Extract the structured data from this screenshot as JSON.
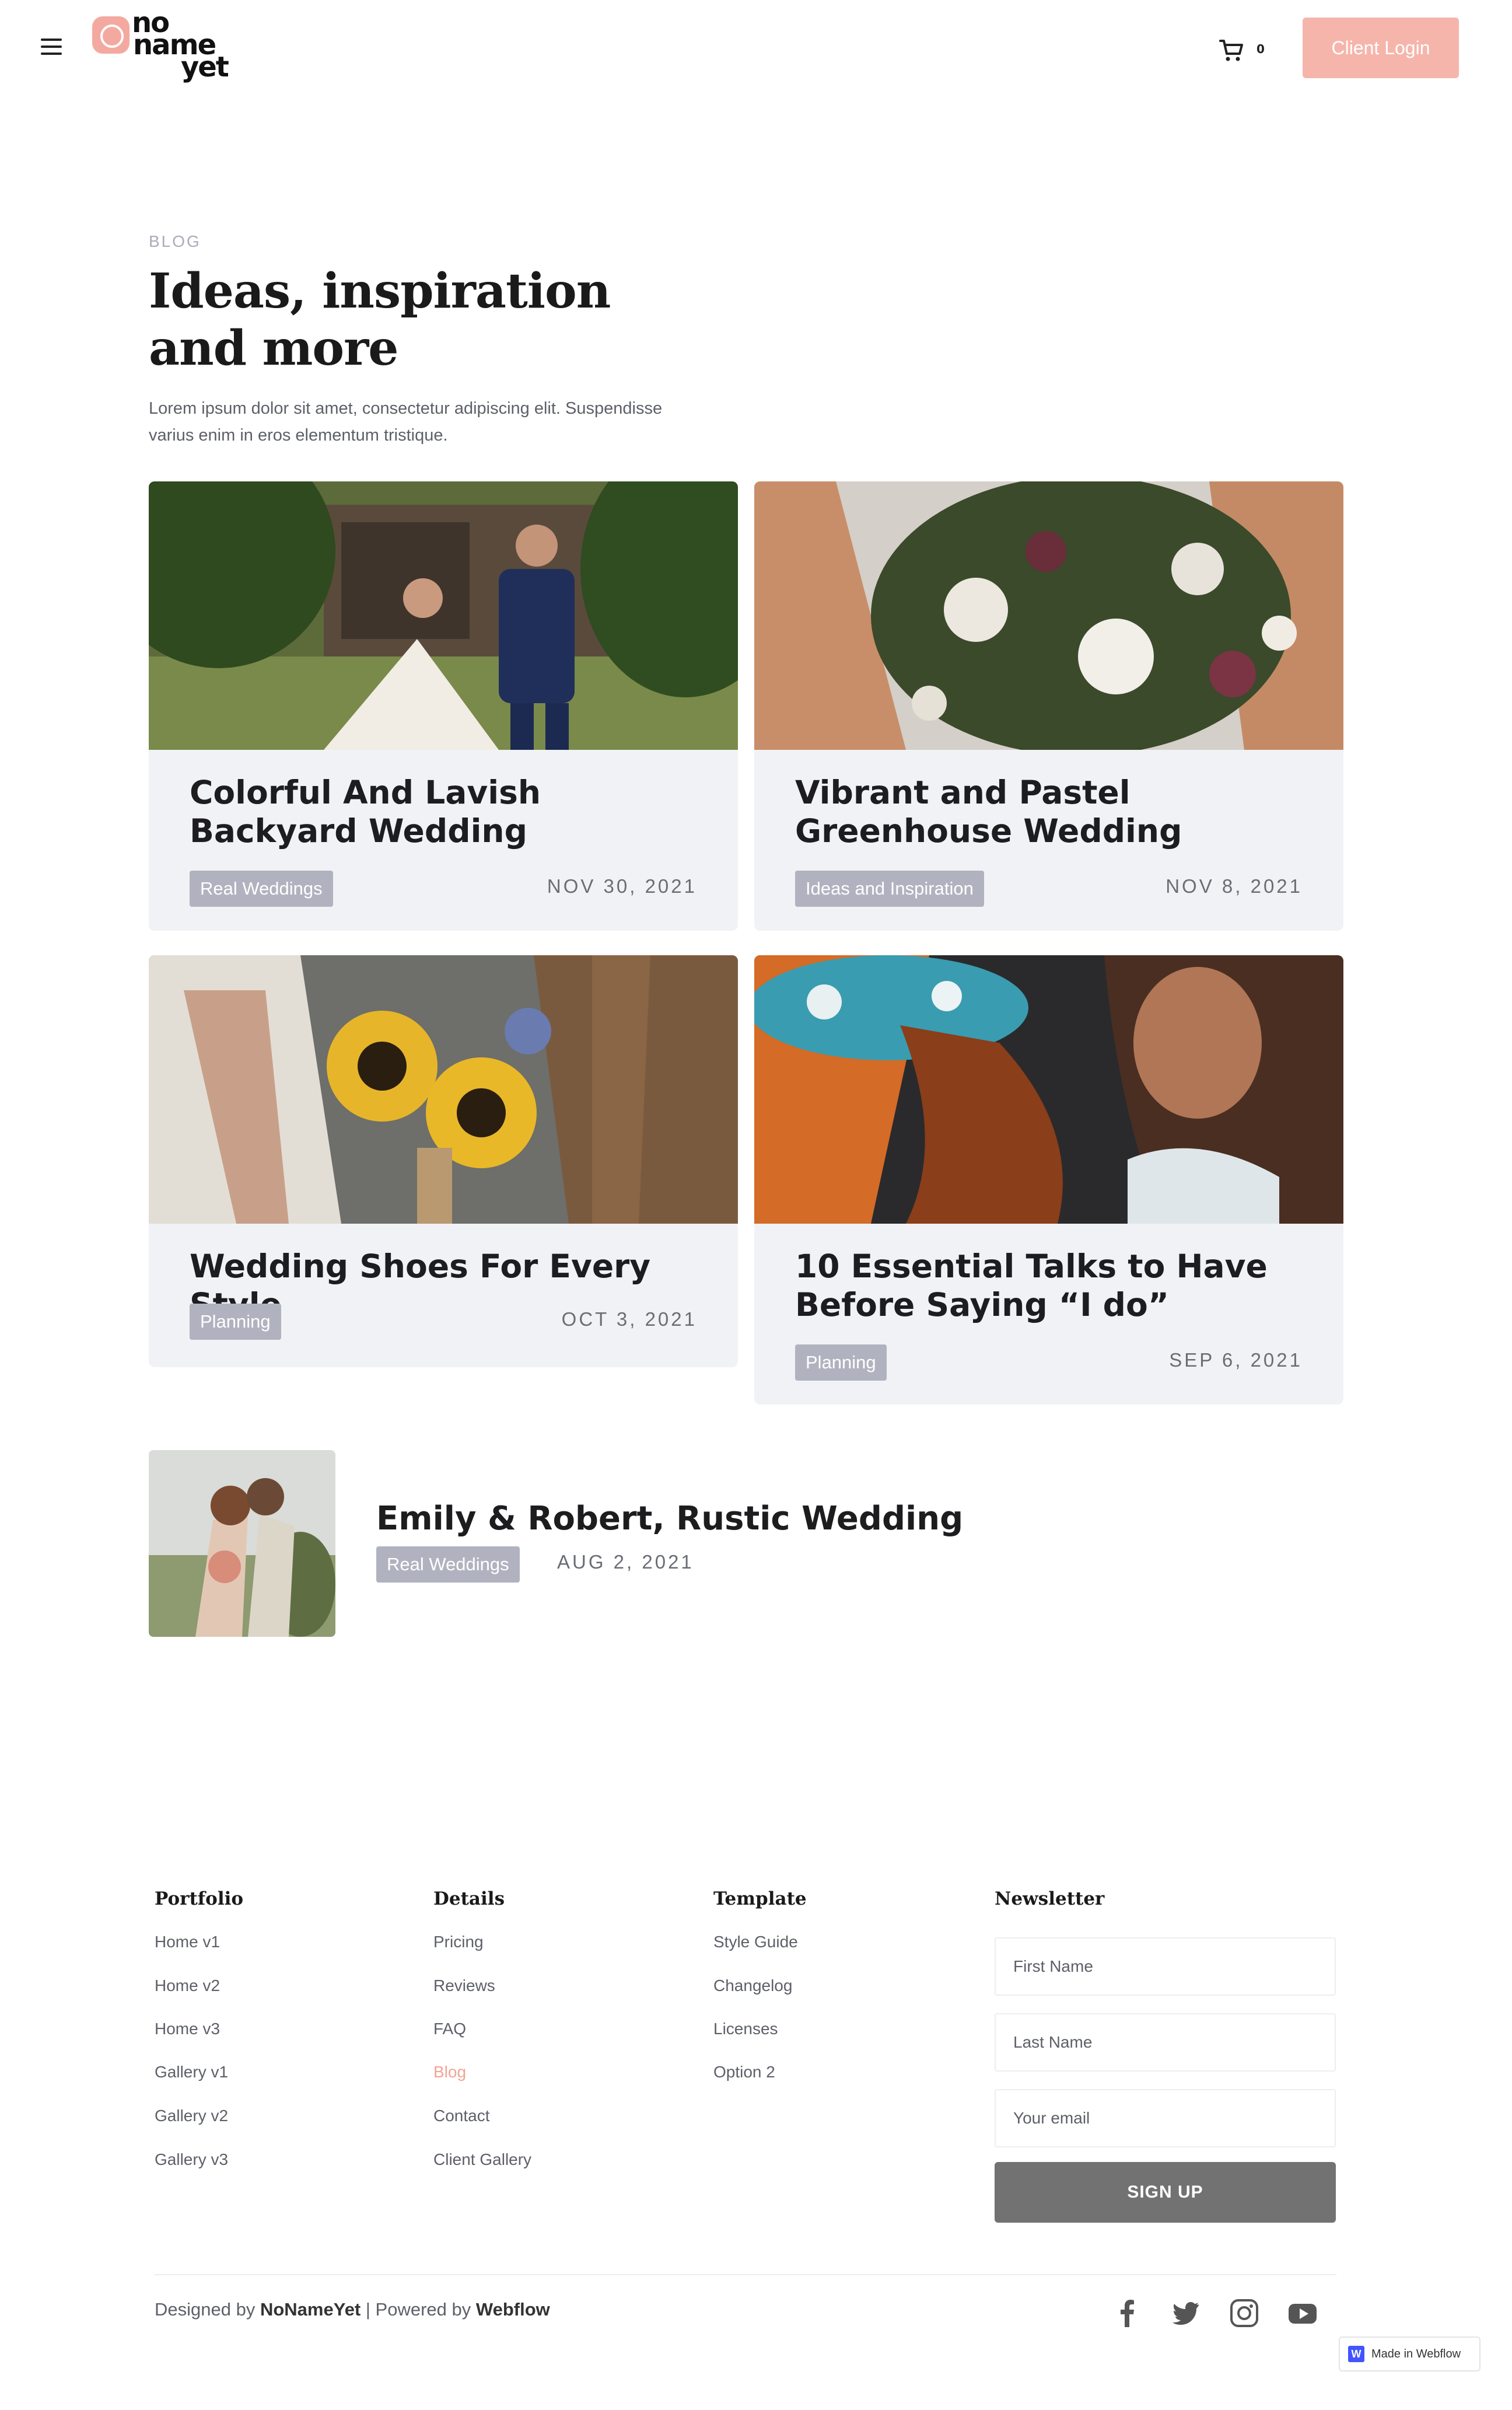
{
  "header": {
    "logo_lines": [
      "no",
      "name",
      "yet"
    ],
    "cart_count": "0",
    "login_label": "Client Login"
  },
  "intro": {
    "eyebrow": "BLOG",
    "title": "Ideas, inspiration and more",
    "description": "Lorem ipsum dolor sit amet, consectetur adipiscing elit. Suspendisse varius enim in eros elementum tristique."
  },
  "posts": [
    {
      "title": "Colorful And Lavish Backyard Wedding",
      "tag": "Real Weddings",
      "date": "NOV 30, 2021"
    },
    {
      "title": "Vibrant and Pastel Greenhouse Wedding",
      "tag": "Ideas and Inspiration",
      "date": "NOV 8, 2021"
    },
    {
      "title": "Wedding Shoes For Every Style",
      "tag": "Planning",
      "date": "OCT 3, 2021"
    },
    {
      "title": "10 Essential Talks to Have Before Saying “I do”",
      "tag": "Planning",
      "date": "SEP 6, 2021"
    }
  ],
  "featured": {
    "title": "Emily & Robert, Rustic Wedding",
    "tag": "Real Weddings",
    "date": "AUG 2, 2021"
  },
  "footer": {
    "columns": [
      {
        "title": "Portfolio",
        "links": [
          "Home v1",
          "Home v2",
          "Home v3",
          "Gallery v1",
          "Gallery v2",
          "Gallery v3"
        ]
      },
      {
        "title": "Details",
        "links": [
          "Pricing",
          "Reviews",
          "FAQ",
          "Blog",
          "Contact",
          "Client Gallery"
        ]
      },
      {
        "title": "Template",
        "links": [
          "Style Guide",
          "Changelog",
          "Licenses",
          "Option 2"
        ]
      }
    ],
    "newsletter": {
      "title": "Newsletter",
      "first_name_placeholder": "First Name",
      "last_name_placeholder": "Last Name",
      "email_placeholder": "Your email",
      "button": "SIGN UP"
    },
    "credits": {
      "designed_by": "Designed by",
      "designer": "NoNameYet",
      "powered_by": "| Powered by",
      "platform": "Webflow"
    },
    "social_icons": [
      "facebook-icon",
      "twitter-icon",
      "instagram-icon",
      "youtube-icon"
    ],
    "badge": "Made in Webflow"
  },
  "colors": {
    "accent": "#f6b5ab",
    "link_active": "#f4a394",
    "tag_bg": "#b0b3bf",
    "card_bg": "#f1f2f5"
  }
}
